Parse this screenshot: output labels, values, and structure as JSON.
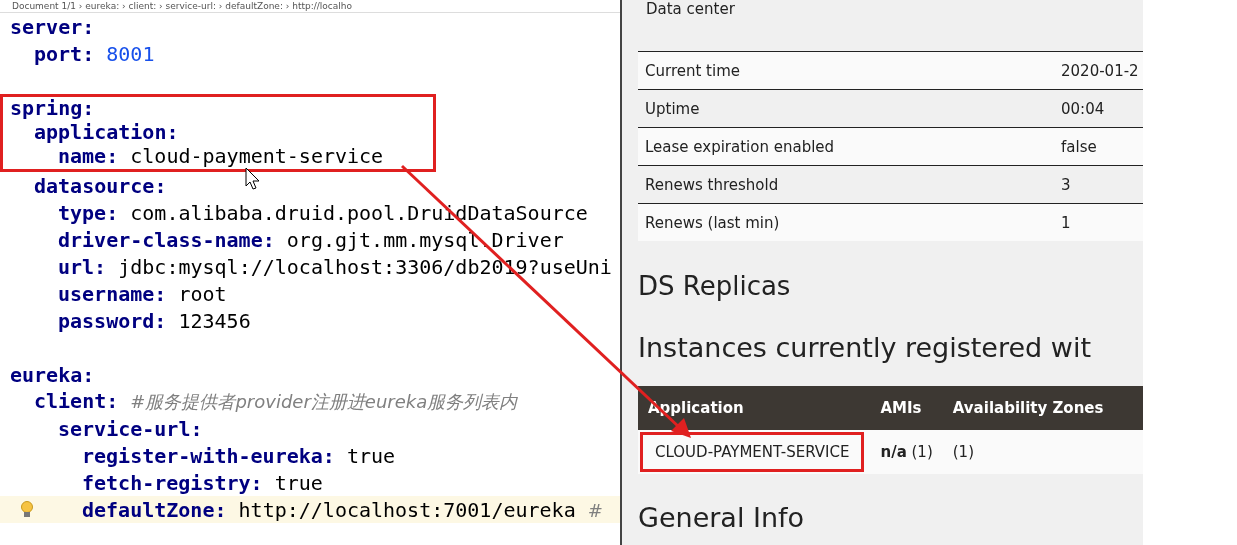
{
  "breadcrumb": "Document 1/1 › eureka: › client: › service-url: › defaultZone: › http://localho",
  "code": [
    {
      "kind": "key",
      "key": "server:",
      "children": [
        {
          "kind": "number",
          "key": "port:",
          "value": "8001"
        }
      ]
    },
    {
      "kind": "blank"
    },
    {
      "kind": "key",
      "key": "spring:",
      "highlighted": true,
      "children": [
        {
          "kind": "key",
          "key": "application:",
          "highlighted": true,
          "children": [
            {
              "kind": "text",
              "key": "name:",
              "value": "cloud-payment-service",
              "highlighted": true
            }
          ]
        },
        {
          "kind": "key",
          "key": "datasource:",
          "children": [
            {
              "kind": "text",
              "key": "type:",
              "value": "com.alibaba.druid.pool.DruidDataSource"
            },
            {
              "kind": "text",
              "key": "driver-class-name:",
              "value": "org.gjt.mm.mysql.Driver"
            },
            {
              "kind": "text",
              "key": "url:",
              "value": "jdbc:mysql://localhost:3306/db2019?useUni"
            },
            {
              "kind": "text",
              "key": "username:",
              "value": "root"
            },
            {
              "kind": "text",
              "key": "password:",
              "value": "123456"
            }
          ]
        }
      ]
    },
    {
      "kind": "blank"
    },
    {
      "kind": "key",
      "key": "eureka:",
      "children": [
        {
          "kind": "key",
          "key": "client:",
          "comment": "#服务提供者provider注册进eureka服务列表内",
          "children": [
            {
              "kind": "key",
              "key": "service-url:",
              "children": [
                {
                  "kind": "text",
                  "key": "register-with-eureka:",
                  "value": "true"
                },
                {
                  "kind": "text",
                  "key": "fetch-registry:",
                  "value": "true"
                },
                {
                  "kind": "text",
                  "key": "defaultZone:",
                  "value": "http://localhost:7001/eureka",
                  "comment": "#",
                  "current": true
                }
              ]
            }
          ]
        }
      ]
    }
  ],
  "eureka_page": {
    "data_center_label": "Data center",
    "info_rows": [
      {
        "label": "Current time",
        "value": "2020-01-2"
      },
      {
        "label": "Uptime",
        "value": "00:04"
      },
      {
        "label": "Lease expiration enabled",
        "value": "false"
      },
      {
        "label": "Renews threshold",
        "value": "3"
      },
      {
        "label": "Renews (last min)",
        "value": "1"
      }
    ],
    "replicas_heading": "DS Replicas",
    "instances_heading": "Instances currently registered wit",
    "table": {
      "columns": [
        "Application",
        "AMIs",
        "Availability Zones"
      ],
      "rows": [
        {
          "application": "CLOUD-PAYMENT-SERVICE",
          "highlighted": true,
          "amis": "**n/a** (1)",
          "availability_zones": "(1)"
        }
      ]
    },
    "general_heading": "General Info"
  }
}
